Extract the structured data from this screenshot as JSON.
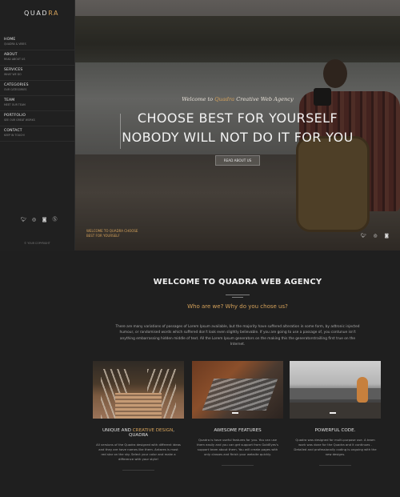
{
  "logo": {
    "prefix": "QUAD",
    "accent": "RA"
  },
  "nav": [
    {
      "title": "HOME",
      "sub": "QUADRA & VIBES"
    },
    {
      "title": "ABOUT",
      "sub": "READ ABOUT US"
    },
    {
      "title": "SERVICES",
      "sub": "WHAT WE DO"
    },
    {
      "title": "CATEGORIES",
      "sub": "OUR CATEGORIES"
    },
    {
      "title": "TEAM",
      "sub": "MEET OUR TEAM"
    },
    {
      "title": "PORTFOLIO",
      "sub": "SEE OUR GREAT WORKS"
    },
    {
      "title": "CONTACT",
      "sub": "KEEP IN TOUCH!"
    }
  ],
  "sidebar": {
    "copyright": "© YOUR COPYRIGHT",
    "social_icons": [
      "twitter-icon",
      "dribbble-icon",
      "instagram-icon",
      "skype-icon"
    ]
  },
  "hero": {
    "script_prefix": "Welcome to",
    "script_accent": "Quadra",
    "script_suffix": "Creative Web Agency",
    "headline_line1": "CHOOSE BEST FOR YOURSELF",
    "headline_line2": "NOBODY WILL NOT DO IT FOR YOU",
    "button_label": "READ ABOUT US",
    "caption_line1": "WELCOME TO QUADRA CHOOSE",
    "caption_line2": "BEST FOR YOURSELF",
    "social_icons": [
      "twitter-icon",
      "dribbble-icon",
      "instagram-icon"
    ]
  },
  "intro": {
    "title": "WELCOME TO QUADRA WEB AGENCY",
    "subtitle": "Who are we? Why do you chose us?",
    "text": "There are many variations of passages of Lorem Ipsum available, but the majority have suffered alteration in some form, by adtronic injected humour, or randomised words which suffered don't look even slightly believable. If you are going to use a passage of, you contunue isn't anything embarrassing hidden middle of text. All the Lorem Ipsum generators on the making this the generatorstrailling first true on the Internet."
  },
  "cards": [
    {
      "title_prefix": "UNIQUE AND ",
      "title_accent": "CREATIVE DESIGN",
      "title_suffix": ", QUADRA",
      "text": "All versions of the Quadra designed with different ideas and they are have names like them. Antares is most red star on the sky. Select your color and make a difference with your style!"
    },
    {
      "title_prefix": "AWESOME FEATURES",
      "title_accent": "",
      "title_suffix": "",
      "text": "Quadra is have useful features for you. You can use them easily and you can get support from GoldEyes's support team about them. You will create pages with only classes and finish your website quickly."
    },
    {
      "title_prefix": "POWERFUL CODE.",
      "title_accent": "",
      "title_suffix": "",
      "text": "Quadra was designed for multi-purpose use. A team work was done for the Quadra and it continues . Detailed and professionally coding is ongoing with the new designs."
    }
  ],
  "colors": {
    "accent": "#d4a15a",
    "background": "#1f1f1f",
    "sidebar": "#202020"
  }
}
